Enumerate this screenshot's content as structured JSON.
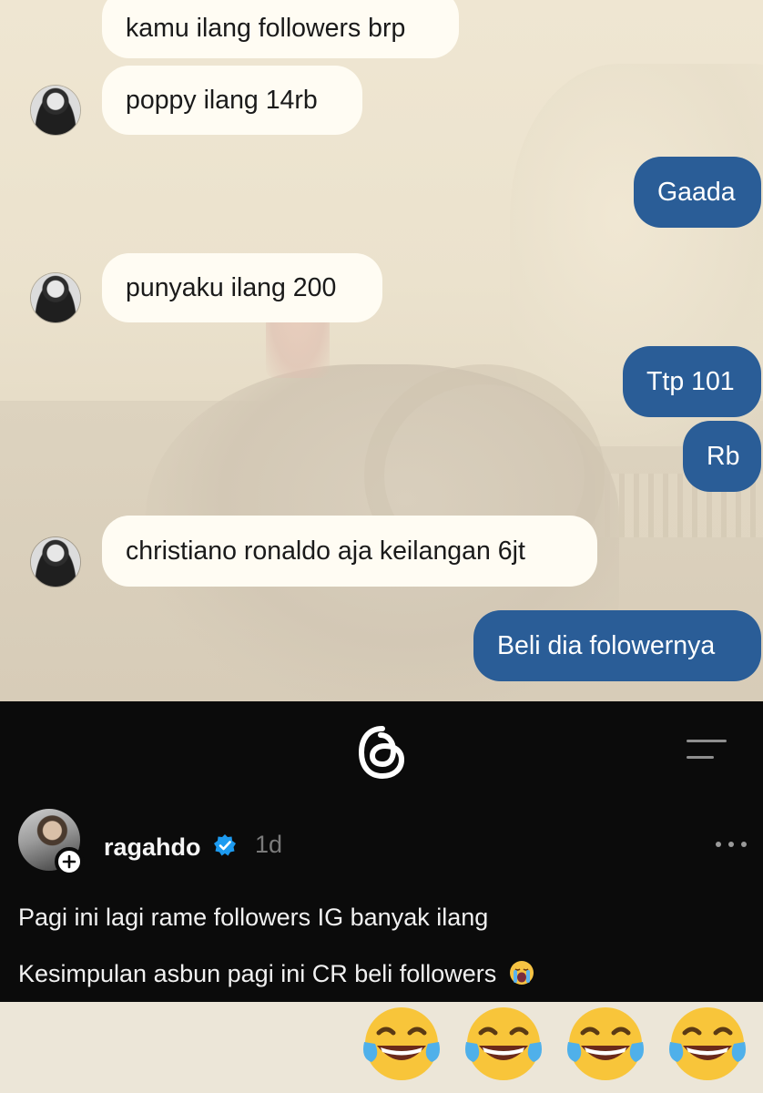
{
  "chat": {
    "messages": [
      {
        "side": "in",
        "text": "kamu ilang followers brp"
      },
      {
        "side": "in",
        "text": "poppy ilang 14rb"
      },
      {
        "side": "out",
        "text": "Gaada"
      },
      {
        "side": "in",
        "text": "punyaku ilang 200"
      },
      {
        "side": "out",
        "text": "Ttp 101"
      },
      {
        "side": "out",
        "text": "Rb"
      },
      {
        "side": "in",
        "text": "christiano ronaldo aja keilangan 6jt"
      },
      {
        "side": "out",
        "text": "Beli dia folowernya"
      }
    ],
    "colors": {
      "incoming_bubble": "#fffcf3",
      "outgoing_bubble": "#2a5d97"
    }
  },
  "threads": {
    "logo_icon": "threads-logo-icon",
    "post": {
      "username": "ragahdo",
      "verified": true,
      "time": "1d",
      "lines": [
        "Pagi ini lagi rame followers IG banyak ilang",
        "Kesimpulan asbun pagi ini CR beli followers"
      ],
      "trailing_emoji": "crying-face-emoji"
    },
    "colors": {
      "background": "#0b0b0b",
      "verified_badge": "#1d9bf0"
    }
  },
  "reactions": {
    "emoji": "tears-of-joy-emoji",
    "count": 4
  }
}
